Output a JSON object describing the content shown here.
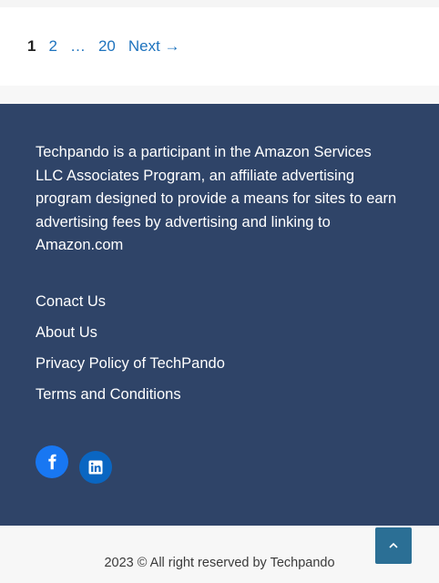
{
  "pagination": {
    "current": "1",
    "page_2": "2",
    "dots": "…",
    "last": "20",
    "next": "Next →"
  },
  "footer": {
    "disclaimer": "Techpando is a participant in the Amazon Services LLC Associates Program, an affiliate advertising program designed to provide a means for sites to earn advertising fees by advertising and linking to Amazon.com",
    "links": [
      "Conact Us",
      "About Us",
      "Privacy Policy of TechPando",
      "Terms and Conditions"
    ],
    "social": [
      "facebook-icon",
      "linkedin-icon"
    ],
    "copyright": "2023 © All right reserved by Techpando"
  },
  "colors": {
    "footer_bg": "#2f4468",
    "link": "#1e73be",
    "back_to_top": "#2b6f95",
    "facebook": "#1877f2",
    "linkedin": "#0a66c2"
  }
}
